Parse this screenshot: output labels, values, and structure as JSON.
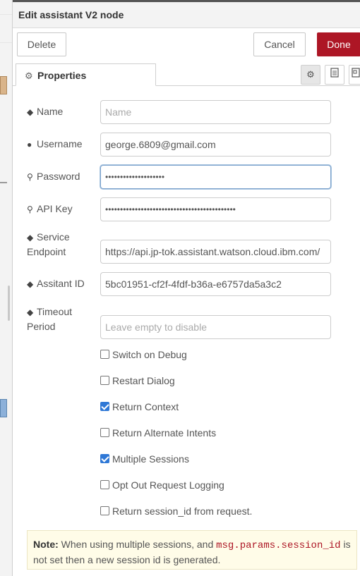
{
  "window": {
    "title": "Edit assistant V2 node"
  },
  "toolbar": {
    "delete_label": "Delete",
    "cancel_label": "Cancel",
    "done_label": "Done",
    "done_color": "#ad1625"
  },
  "tabs": {
    "properties_label": "Properties",
    "icons": [
      "gear-icon",
      "description-icon",
      "appearance-icon"
    ]
  },
  "form": {
    "name": {
      "label": "Name",
      "value": "",
      "placeholder": "Name",
      "icon": "tag-icon"
    },
    "username": {
      "label": "Username",
      "value": "george.6809@gmail.com",
      "icon": "user-icon"
    },
    "password": {
      "label": "Password",
      "value": "••••••••••••••••••••",
      "icon": "key-icon"
    },
    "api_key": {
      "label": "API Key",
      "value": "••••••••••••••••••••••••••••••••••••••••••••",
      "icon": "key-icon"
    },
    "service_endpoint": {
      "label_line1": "Service",
      "label_line2": "Endpoint",
      "value": "https://api.jp-tok.assistant.watson.cloud.ibm.com/",
      "icon": "tag-icon"
    },
    "assistant_id": {
      "label": "Assitant ID",
      "value": "5bc01951-cf2f-4fdf-b36a-e6757da5a3c2",
      "icon": "tag-icon"
    },
    "timeout": {
      "label_line1": "Timeout",
      "label_line2": "Period",
      "value": "",
      "placeholder": "Leave empty to disable",
      "icon": "tag-icon"
    }
  },
  "checkboxes": [
    {
      "label": "Switch on Debug",
      "checked": false
    },
    {
      "label": "Restart Dialog",
      "checked": false
    },
    {
      "label": "Return Context",
      "checked": true
    },
    {
      "label": "Return Alternate Intents",
      "checked": false
    },
    {
      "label": "Multiple Sessions",
      "checked": true
    },
    {
      "label": "Opt Out Request Logging",
      "checked": false
    },
    {
      "label": "Return session_id from request.",
      "checked": false
    }
  ],
  "note": {
    "title": "Note:",
    "text_before": " When using multiple sessions, and ",
    "code": "msg.params.session_id",
    "text_after": " is not set then a new session id is generated."
  }
}
